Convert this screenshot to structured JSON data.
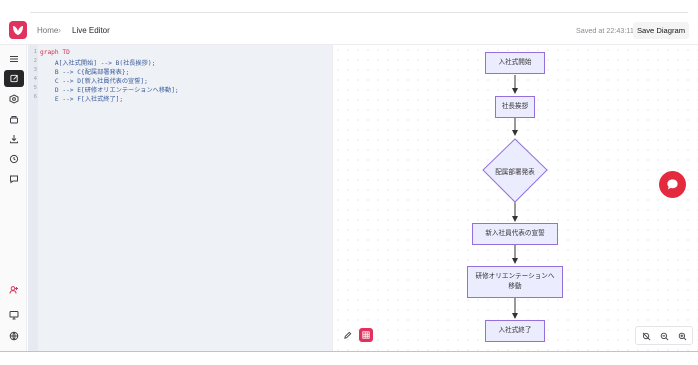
{
  "header": {
    "breadcrumb_home": "Home",
    "breadcrumb_separator": "›",
    "breadcrumb_current": "Live Editor",
    "saved_status": "Saved at 22:43:11",
    "save_button": "Save Diagram"
  },
  "sidebar": {
    "items": [
      {
        "name": "menu",
        "icon": "menu-icon"
      },
      {
        "name": "code",
        "icon": "code-edit-icon",
        "active": true
      },
      {
        "name": "config",
        "icon": "config-icon"
      },
      {
        "name": "sample",
        "icon": "sample-diagram-icon"
      },
      {
        "name": "export",
        "icon": "download-icon"
      },
      {
        "name": "history",
        "icon": "history-icon"
      },
      {
        "name": "comments",
        "icon": "comment-icon"
      },
      {
        "name": "add-user",
        "icon": "add-user-icon"
      },
      {
        "name": "present",
        "icon": "monitor-icon"
      },
      {
        "name": "language",
        "icon": "globe-icon"
      }
    ]
  },
  "editor": {
    "line_numbers": [
      "1",
      "2",
      "3",
      "4",
      "5",
      "6"
    ],
    "lines": [
      "graph TD",
      "    A[入社式開始] --> B(社長挨拶);",
      "    B --> C{配属部署発表};",
      "    C --> D[新入社員代表の宣誓];",
      "    D --> E[研修オリエンテーションへ移動];",
      "    E --> F[入社式終了];"
    ]
  },
  "diagram": {
    "nodes": {
      "A": "入社式開始",
      "B": "社長挨拶",
      "C": "配属部署発表",
      "D": "新入社員代表の宣誓",
      "E1": "研修オリエンテーションへ",
      "E2": "移動",
      "F": "入社式終了"
    },
    "colors": {
      "node_fill": "#ececff",
      "node_stroke": "#9370db",
      "edge": "#333333",
      "accent": "#e0325c"
    }
  },
  "preview_tools": {
    "edit_icon": "pencil-icon",
    "grid_icon": "grid-icon",
    "zoom": [
      "reset-zoom-icon",
      "zoom-out-icon",
      "zoom-in-icon"
    ]
  },
  "chat_widget": {
    "icon": "chat-bubble-icon",
    "color": "#e42a3e"
  }
}
